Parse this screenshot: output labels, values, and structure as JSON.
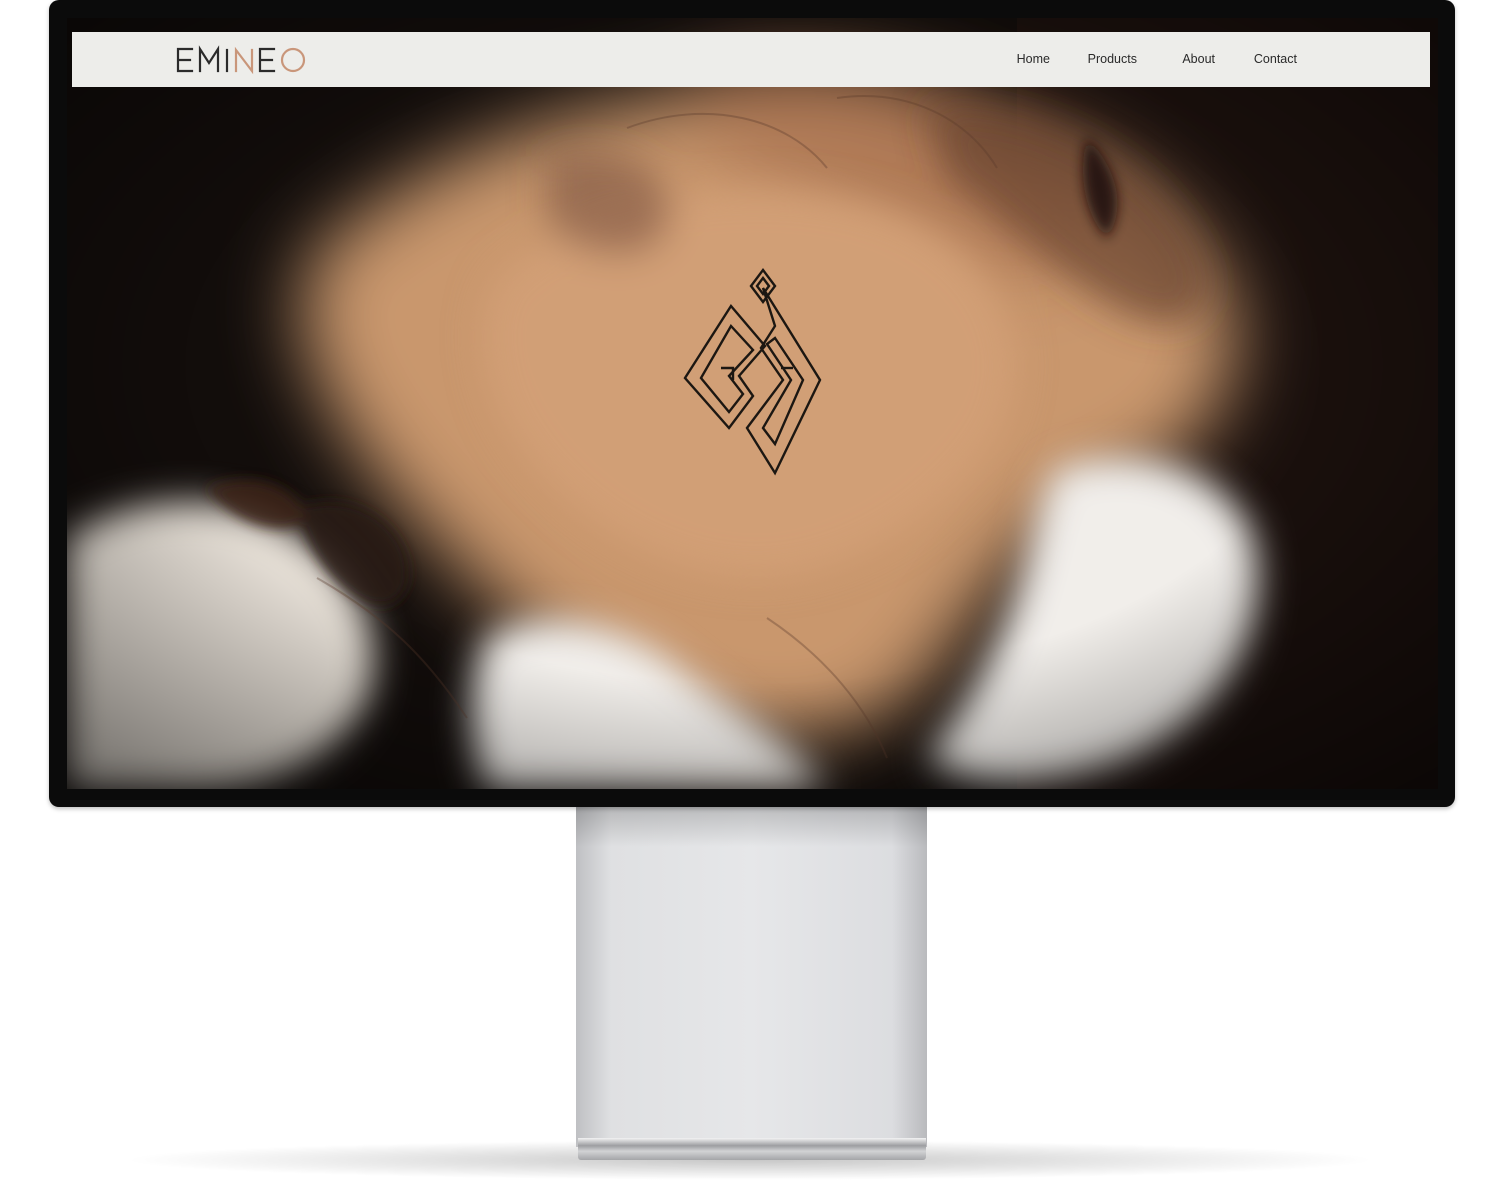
{
  "site": {
    "brand": "EMINEO",
    "nav": {
      "home": "Home",
      "products": "Products",
      "about": "About",
      "contact": "Contact"
    }
  },
  "colors": {
    "navbar_bg": "#ededea",
    "accent_copper": "#c9967a",
    "hero_tan": "#c9976d",
    "hero_dark": "#120c09",
    "hero_cream": "#f1eeea"
  },
  "icons": {
    "emblem": "diamond-monogram-icon"
  }
}
